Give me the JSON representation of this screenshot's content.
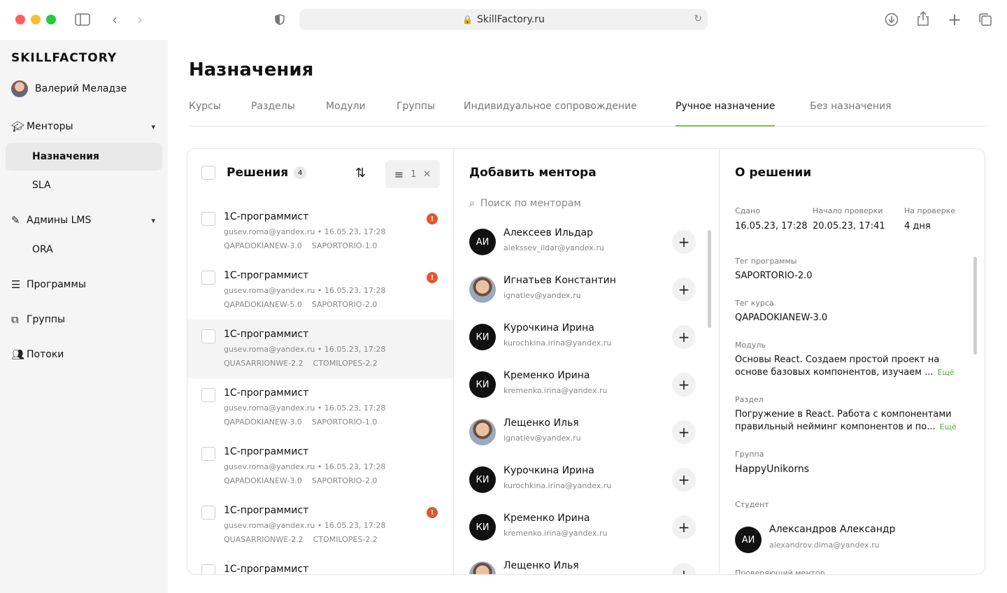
{
  "browser": {
    "url": "SkillFactory.ru"
  },
  "sidebar": {
    "logo": "SKILLFACTORY",
    "user_name": "Валерий Меладзе",
    "items": [
      {
        "label": "Менторы"
      },
      {
        "label": "Назначения"
      },
      {
        "label": "SLA"
      },
      {
        "label": "Админы LMS"
      },
      {
        "label": "ORA"
      },
      {
        "label": "Программы"
      },
      {
        "label": "Группы"
      },
      {
        "label": "Потоки"
      }
    ]
  },
  "page": {
    "title": "Назначения",
    "tabs": [
      {
        "label": "Курсы"
      },
      {
        "label": "Разделы"
      },
      {
        "label": "Модули"
      },
      {
        "label": "Группы"
      },
      {
        "label": "Индивидуальное сопровождение"
      },
      {
        "label": "Ручное назначение"
      },
      {
        "label": "Без назначения"
      }
    ]
  },
  "solutions": {
    "title": "Решения",
    "count": "4",
    "filter_count": "1",
    "items": [
      {
        "title": "1С-программист",
        "email": "gusev.roma@yandex.ru",
        "date": "16.05.23, 17:28",
        "tags": "QAPADOKIANEW-3.0    SAPORTORIO-1.0",
        "warn": "!"
      },
      {
        "title": "1С-программист",
        "email": "gusev.roma@yandex.ru",
        "date": "16.05.23, 17:28",
        "tags": "QAPADOKIANEW-5.0    SAPORTORIO-2.0",
        "warn": "!"
      },
      {
        "title": "1С-программист",
        "email": "gusev.roma@yandex.ru",
        "date": "16.05.23, 17:28",
        "tags": "QUASARRIONWE-2.2    CTOMILOPES-2.2",
        "warn": ""
      },
      {
        "title": "1С-программист",
        "email": "gusev.roma@yandex.ru",
        "date": "16.05.23, 17:28",
        "tags": "QAPADOKIANEW-3.0    SAPORTORIO-1.0",
        "warn": ""
      },
      {
        "title": "1С-программист",
        "email": "gusev.roma@yandex.ru",
        "date": "16.05.23, 17:28",
        "tags": "QAPADOKIANEW-3.0    SAPORTORIO-2.0",
        "warn": ""
      },
      {
        "title": "1С-программист",
        "email": "gusev.roma@yandex.ru",
        "date": "16.05.23, 17:28",
        "tags": "QUASARRIONWE-2.2    CTOMILOPES-2.2",
        "warn": "!"
      },
      {
        "title": "1С-программист",
        "email": "",
        "date": "",
        "tags": "",
        "warn": ""
      }
    ]
  },
  "mentors": {
    "title": "Добавить ментора",
    "search_placeholder": "Поиск по менторам",
    "items": [
      {
        "initials": "АИ",
        "name": "Алексеев Ильдар",
        "email": "alekssev_ildar@yandex.ru"
      },
      {
        "initials": "",
        "name": "Игнатьев Константин",
        "email": "ignatiev@yandex.ru"
      },
      {
        "initials": "КИ",
        "name": "Курочкина Ирина",
        "email": "kurochkina.irina@yandex.ru"
      },
      {
        "initials": "КИ",
        "name": "Кременко Ирина",
        "email": "kremenko.irina@yandex.ru"
      },
      {
        "initials": "",
        "name": "Лещенко Илья",
        "email": "ignatiev@yandex.ru"
      },
      {
        "initials": "КИ",
        "name": "Курочкина Ирина",
        "email": "kurochkina.irina@yandex.ru"
      },
      {
        "initials": "КИ",
        "name": "Кременко Ирина",
        "email": "kremenko.irina@yandex.ru"
      },
      {
        "initials": "",
        "name": "Лещенко Илья",
        "email": ""
      }
    ]
  },
  "details": {
    "title": "О решении",
    "submitted_label": "Сдано",
    "submitted_value": "16.05.23, 17:28",
    "review_start_label": "Начало проверки",
    "review_start_value": "20.05.23, 17:41",
    "in_review_label": "На проверке",
    "in_review_value": "4 дня",
    "program_tag_label": "Тег программы",
    "program_tag_value": "SAPORTORIO-2.0",
    "course_tag_label": "Тег курса",
    "course_tag_value": "QAPADOKIANEW-3.0",
    "module_label": "Модуль",
    "module_line1": "Основы React. Создаем простой проект на",
    "module_line2": "основе базовых компонентов, изучаем ...",
    "section_label": "Раздел",
    "section_line1": "Погружение в React. Работа с компонентами",
    "section_line2": "правильный нейминг компонентов и по...",
    "more_label": "Ещё",
    "group_label": "Группа",
    "group_value": "HappyUnikorns",
    "student_label": "Студент",
    "student_initials": "АИ",
    "student_name": "Александров Александр",
    "student_email": "alexandrov.dima@yandex.ru",
    "reviewer_label": "Проверяющий ментор"
  }
}
